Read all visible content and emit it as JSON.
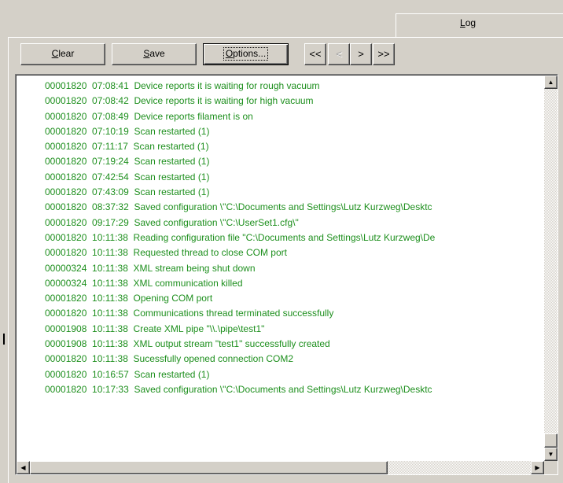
{
  "tab": {
    "label_prefix": "L",
    "label_rest": "og"
  },
  "toolbar": {
    "clear": {
      "mnemonic": "C",
      "rest": "lear"
    },
    "save": {
      "mnemonic": "S",
      "rest": "ave"
    },
    "options": {
      "mnemonic": "O",
      "rest": "ptions..."
    },
    "first": "<<",
    "prev": "<",
    "next": ">",
    "last": ">>"
  },
  "colors": {
    "log_text": "#1d8f1d",
    "window_bg": "#d4d0c8"
  },
  "log": {
    "lines": [
      "00001820  07:08:41  Device reports it is waiting for rough vacuum",
      "00001820  07:08:42  Device reports it is waiting for high vacuum",
      "00001820  07:08:49  Device reports filament is on",
      "00001820  07:10:19  Scan restarted (1)",
      "00001820  07:11:17  Scan restarted (1)",
      "00001820  07:19:24  Scan restarted (1)",
      "00001820  07:42:54  Scan restarted (1)",
      "00001820  07:43:09  Scan restarted (1)",
      "00001820  08:37:32  Saved configuration \\\"C:\\Documents and Settings\\Lutz Kurzweg\\Desktc",
      "00001820  09:17:29  Saved configuration \\\"C:\\UserSet1.cfg\\\"",
      "00001820  10:11:38  Reading configuration file \"C:\\Documents and Settings\\Lutz Kurzweg\\De",
      "00001820  10:11:38  Requested thread to close COM port",
      "00000324  10:11:38  XML stream being shut down",
      "00000324  10:11:38  XML communication killed",
      "00001820  10:11:38  Opening COM port",
      "00001820  10:11:38  Communications thread terminated successfully",
      "00001908  10:11:38  Create XML pipe \"\\\\.\\pipe\\test1\"",
      "00001908  10:11:38  XML output stream \"test1\" successfully created",
      "00001820  10:11:38  Sucessfully opened connection COM2",
      "00001820  10:16:57  Scan restarted (1)",
      "00001820  10:17:33  Saved configuration \\\"C:\\Documents and Settings\\Lutz Kurzweg\\Desktc"
    ]
  },
  "scrollbars": {
    "up_icon": "triangle-up",
    "down_icon": "triangle-down",
    "left_icon": "triangle-left",
    "right_icon": "triangle-right"
  }
}
